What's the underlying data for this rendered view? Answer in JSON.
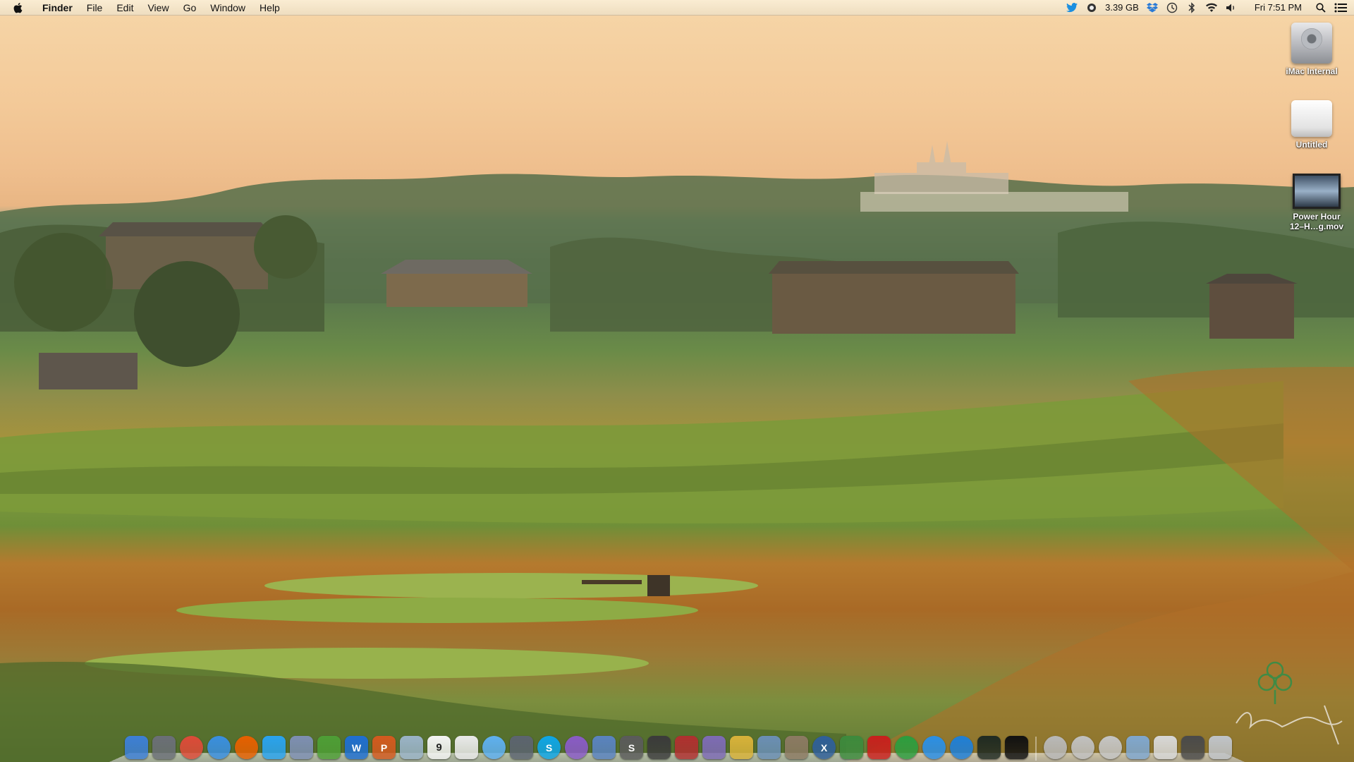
{
  "menubar": {
    "apple": "apple-icon",
    "app_name": "Finder",
    "menus": [
      "File",
      "Edit",
      "View",
      "Go",
      "Window",
      "Help"
    ],
    "status": {
      "memory": "3.39 GB",
      "clock": "Fri 7:51 PM"
    },
    "status_icons": [
      "twitter-icon",
      "memory-icon",
      "dropbox-icon",
      "time-machine-icon",
      "bluetooth-icon",
      "wifi-icon",
      "volume-icon",
      "spotlight-icon",
      "notification-center-icon"
    ]
  },
  "desktop_icons": [
    {
      "label": "iMac Internal",
      "icon": "hard-drive-icon"
    },
    {
      "label": "Untitled",
      "icon": "external-drive-icon"
    },
    {
      "label": "Power Hour 12–H…g.mov",
      "label_line1": "Power Hour",
      "label_line2": "12–H…g.mov",
      "icon": "movie-file-icon"
    }
  ],
  "dock": {
    "apps": [
      {
        "name": "finder-icon",
        "color": "#3d7fd6"
      },
      {
        "name": "launchpad-icon",
        "color": "#6b6f77"
      },
      {
        "name": "chrome-icon",
        "color": "#dd4b39"
      },
      {
        "name": "safari-icon",
        "color": "#3a8fe0"
      },
      {
        "name": "firefox-icon",
        "color": "#e66000"
      },
      {
        "name": "twitter-icon",
        "color": "#2aa3ef"
      },
      {
        "name": "mail-stamp-icon",
        "color": "#7e8fb3"
      },
      {
        "name": "evernote-icon",
        "color": "#4e9e36"
      },
      {
        "name": "word-icon",
        "color": "#1f6fd1"
      },
      {
        "name": "powerpoint-icon",
        "color": "#d35a1f"
      },
      {
        "name": "preview-icon",
        "color": "#9ab3c7"
      },
      {
        "name": "calendar-icon",
        "color": "#f4f4f4"
      },
      {
        "name": "textedit-icon",
        "color": "#e9e9e9"
      },
      {
        "name": "messages-icon",
        "color": "#5fb0f0"
      },
      {
        "name": "facetime-icon",
        "color": "#5c6470"
      },
      {
        "name": "skype-icon",
        "color": "#0fa6e6"
      },
      {
        "name": "siri-icon",
        "color": "#8a5bc7"
      },
      {
        "name": "xcode-icon",
        "color": "#5a83c0"
      },
      {
        "name": "sublime-text-icon",
        "color": "#5b5b5b"
      },
      {
        "name": "final-cut-icon",
        "color": "#3b3b3b"
      },
      {
        "name": "photo-booth-icon",
        "color": "#b03030"
      },
      {
        "name": "imovie-icon",
        "color": "#7e6bb5"
      },
      {
        "name": "pineapple-icon",
        "color": "#d8b23a"
      },
      {
        "name": "iphoto-icon",
        "color": "#6b8fb5"
      },
      {
        "name": "gimp-icon",
        "color": "#8c7a63"
      },
      {
        "name": "x11-icon",
        "color": "#2f5f9a"
      },
      {
        "name": "memory-clean-icon",
        "color": "#3d8a3d"
      },
      {
        "name": "pokerstars-icon",
        "color": "#c8201d"
      },
      {
        "name": "spotify-icon",
        "color": "#2c9d3f"
      },
      {
        "name": "itunes-icon",
        "color": "#2a8fe6"
      },
      {
        "name": "app-store-icon",
        "color": "#1e7fd8"
      },
      {
        "name": "activity-monitor-icon",
        "color": "#1f2a22"
      },
      {
        "name": "terminal-icon",
        "color": "#111111"
      }
    ],
    "stacks": [
      {
        "name": "downloads-stack-icon",
        "color": "#b8b8b8"
      },
      {
        "name": "documents-stack-icon",
        "color": "#c0c0c0"
      },
      {
        "name": "applications-stack-icon",
        "color": "#c4c4c4"
      },
      {
        "name": "folder-stack-icon",
        "color": "#7fa7cf"
      },
      {
        "name": "web-stack-icon",
        "color": "#d7d7d7"
      },
      {
        "name": "screenshots-stack-icon",
        "color": "#4a4a4a"
      },
      {
        "name": "trash-icon",
        "color": "#bfc3c8"
      }
    ],
    "calendar_day": "9",
    "word_glyph": "W",
    "powerpoint_glyph": "P",
    "skype_glyph": "S",
    "x11_glyph": "X",
    "sublime_glyph": "S"
  },
  "colors": {
    "sky": "#f3c998",
    "foliage": "#5c7a4c",
    "fairway": "#7f9a3e",
    "rough": "#b57a2e",
    "menubar": "#f4e6c8"
  }
}
